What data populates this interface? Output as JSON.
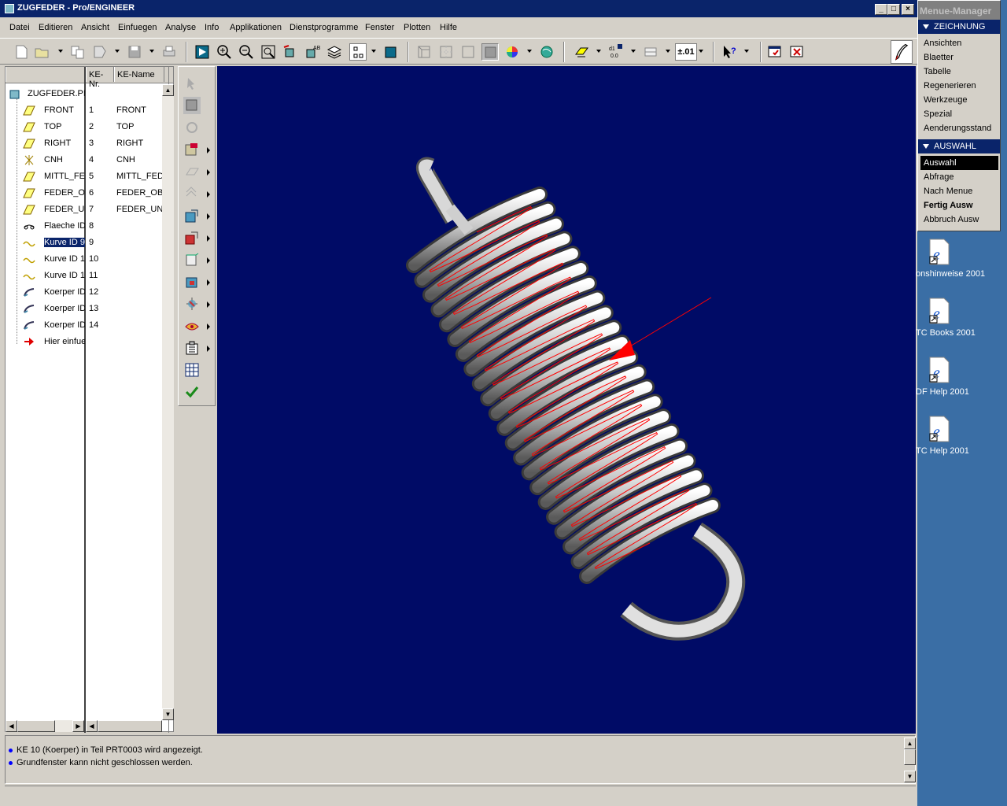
{
  "window": {
    "title": "ZUGFEDER - Pro/ENGINEER",
    "controls": [
      "minimize",
      "maximize",
      "close"
    ]
  },
  "menu": {
    "items": [
      "Datei",
      "Editieren",
      "Ansicht",
      "Einfuegen",
      "Analyse",
      "Info",
      "Applikationen",
      "Dienstprogramme",
      "Fenster",
      "Plotten",
      "Hilfe"
    ]
  },
  "toolbar": {
    "tolerance_label": "±.01",
    "dims_label": "d1 0.0"
  },
  "tree": {
    "col_nr": "KE-Nr.",
    "col_name": "KE-Name",
    "root": "ZUGFEDER.PI",
    "rows": [
      {
        "name": "FRONT",
        "nr": "1",
        "ke": "FRONT",
        "icon": "datum-plane-icon"
      },
      {
        "name": "TOP",
        "nr": "2",
        "ke": "TOP",
        "icon": "datum-plane-icon"
      },
      {
        "name": "RIGHT",
        "nr": "3",
        "ke": "RIGHT",
        "icon": "datum-plane-icon"
      },
      {
        "name": "CNH",
        "nr": "4",
        "ke": "CNH",
        "icon": "csys-icon"
      },
      {
        "name": "MITTL_FE",
        "nr": "5",
        "ke": "MITTL_FED",
        "icon": "datum-plane-icon"
      },
      {
        "name": "FEDER_O",
        "nr": "6",
        "ke": "FEDER_OB",
        "icon": "datum-plane-icon"
      },
      {
        "name": "FEDER_U",
        "nr": "7",
        "ke": "FEDER_UN",
        "icon": "datum-plane-icon"
      },
      {
        "name": "Flaeche ID",
        "nr": "8",
        "ke": "",
        "icon": "surface-icon"
      },
      {
        "name": "Kurve ID 9",
        "nr": "9",
        "ke": "",
        "icon": "curve-icon",
        "selected": true
      },
      {
        "name": "Kurve ID 1",
        "nr": "10",
        "ke": "",
        "icon": "curve-icon"
      },
      {
        "name": "Kurve ID 1",
        "nr": "11",
        "ke": "",
        "icon": "curve-icon"
      },
      {
        "name": "Koerper ID",
        "nr": "12",
        "ke": "",
        "icon": "sweep-icon"
      },
      {
        "name": "Koerper ID",
        "nr": "13",
        "ke": "",
        "icon": "sweep-icon"
      },
      {
        "name": "Koerper ID",
        "nr": "14",
        "ke": "",
        "icon": "sweep-icon"
      },
      {
        "name": "Hier einfue",
        "nr": "",
        "ke": "",
        "icon": "insert-here-arrow-icon"
      }
    ]
  },
  "messages": [
    "KE 10 (Koerper) in Teil PRT0003 wird angezeigt.",
    "Grundfenster kann nicht geschlossen werden."
  ],
  "menu_manager": {
    "title": "Menue-Manager",
    "section1": "ZEICHNUNG",
    "section1_items": [
      "Ansichten",
      "Blaetter",
      "Tabelle",
      "Regenerieren",
      "Werkzeuge",
      "Spezial",
      "Aenderungsstand"
    ],
    "section2": "AUSWAHL",
    "section2_items": [
      "Auswahl",
      "Abfrage",
      "Nach Menue",
      "Fertig Ausw",
      "Abbruch Ausw"
    ]
  },
  "desktop_icons": [
    "onshinweise 2001",
    "TC Books 2001",
    "DF Help 2001",
    "TC Help 2001"
  ],
  "colors": {
    "graphics_bg": "#000b66",
    "titlebar": "#0a246a",
    "desktop": "#3a6ea5",
    "curve": "#ff0000"
  }
}
